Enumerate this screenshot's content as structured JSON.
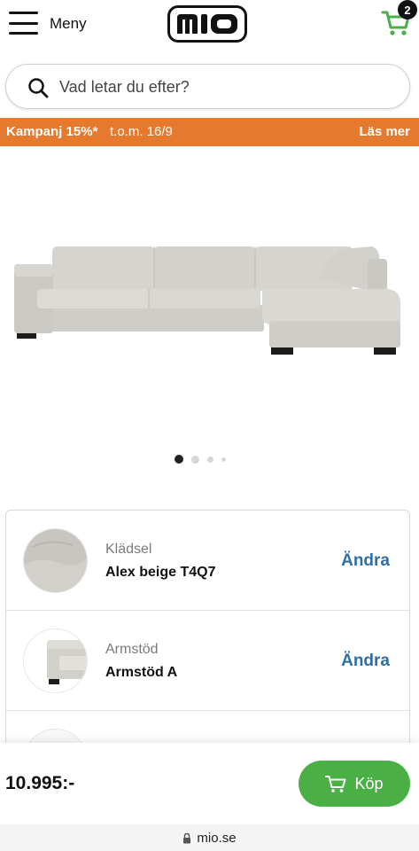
{
  "header": {
    "menu_label": "Meny",
    "logo_text": "MIO",
    "cart_count": "2",
    "cart_icon": "shopping-cart-icon",
    "accent_color": "#4ab046"
  },
  "search": {
    "placeholder": "Vad letar du efter?",
    "value": ""
  },
  "promo": {
    "title": "Kampanj 15%*",
    "date": "t.o.m. 16/9",
    "link": "Läs mer",
    "color": "#e57a2f"
  },
  "product": {
    "image_alt": "corner-sofa-image",
    "carousel_count": 4,
    "carousel_active": 1
  },
  "options": [
    {
      "label": "Klädsel",
      "value": "Alex beige T4Q7",
      "action": "Ändra"
    },
    {
      "label": "Armstöd",
      "value": "Armstöd A",
      "action": "Ändra"
    },
    {
      "label": "",
      "value": "",
      "action": ""
    }
  ],
  "buy": {
    "price": "10.995:-",
    "button_label": "Köp",
    "button_color": "#4ab046"
  },
  "browser": {
    "url": "mio.se"
  }
}
